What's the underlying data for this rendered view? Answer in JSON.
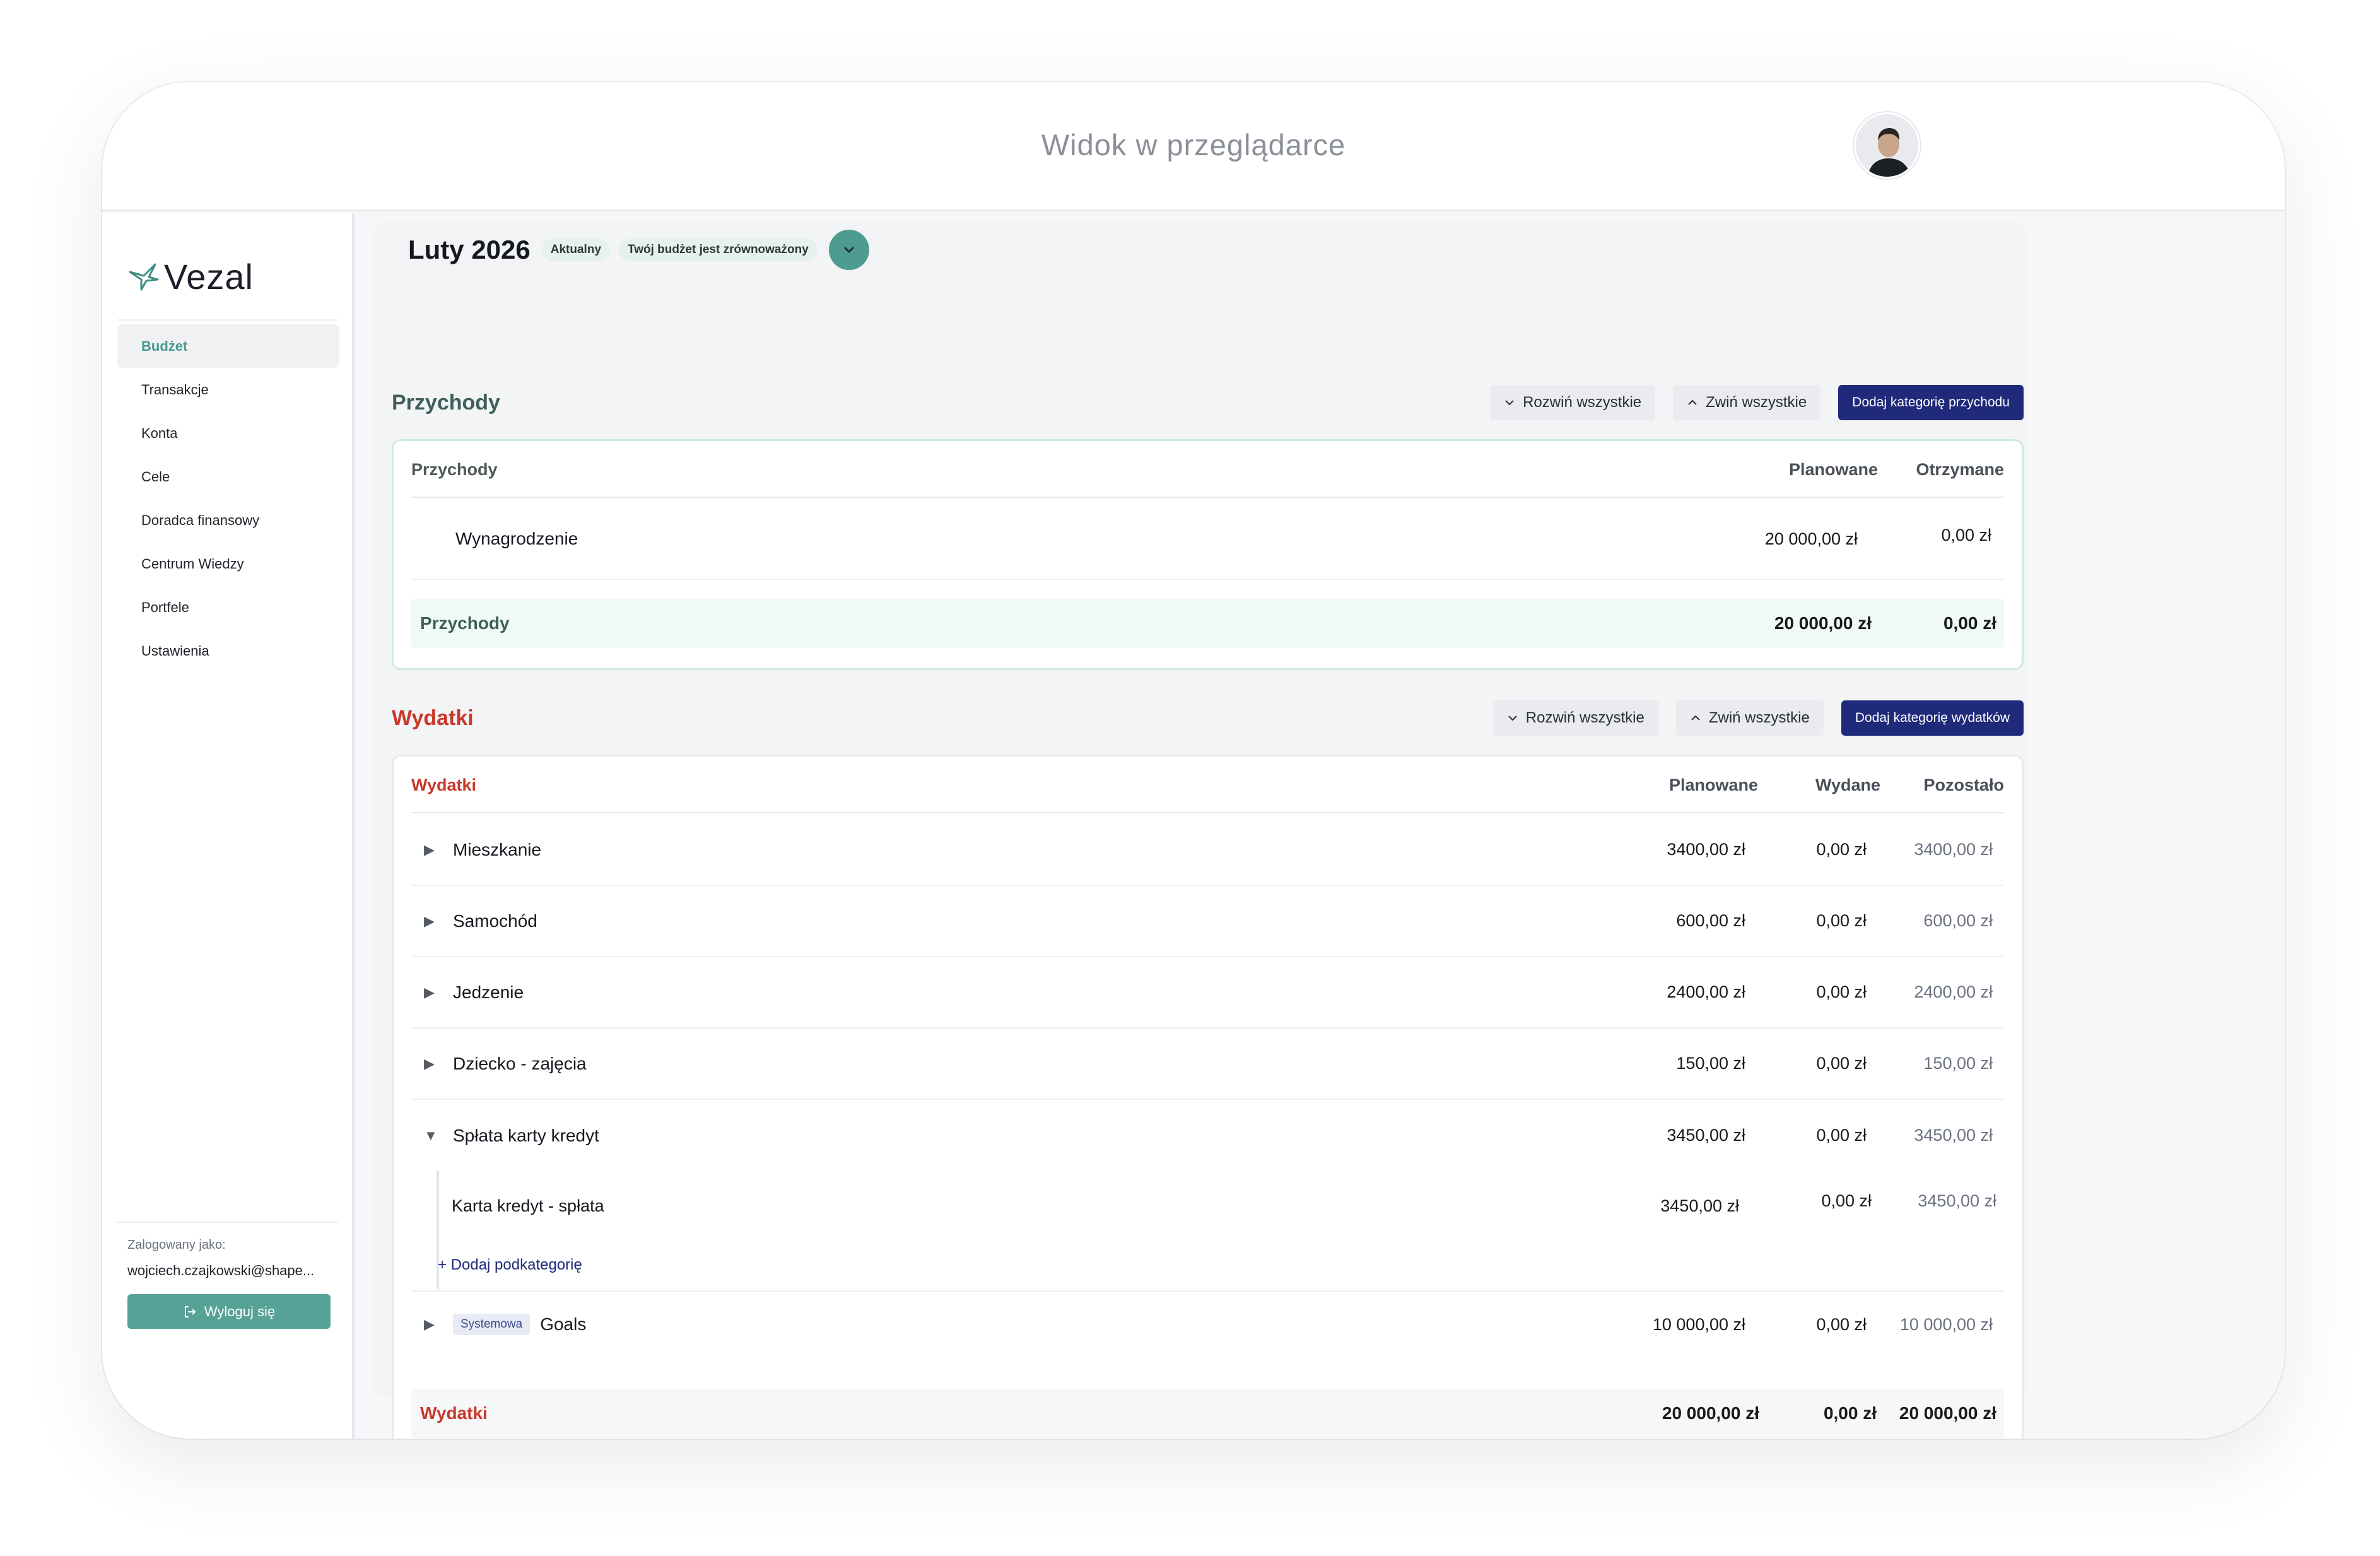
{
  "topbar": {
    "title": "Widok w przeglądarce"
  },
  "sidebar": {
    "logo": "Vezal",
    "items": [
      {
        "label": "Budżet"
      },
      {
        "label": "Transakcje"
      },
      {
        "label": "Konta"
      },
      {
        "label": "Cele"
      },
      {
        "label": "Doradca finansowy"
      },
      {
        "label": "Centrum Wiedzy"
      },
      {
        "label": "Portfele"
      },
      {
        "label": "Ustawienia"
      }
    ],
    "logged_label": "Zalogowany jako:",
    "email": "wojciech.czajkowski@shape...",
    "logout_label": "Wyloguj się"
  },
  "header": {
    "month": "Luty 2026",
    "badge_current": "Aktualny",
    "badge_status": "Twój budżet jest zrównoważony"
  },
  "income": {
    "title": "Przychody",
    "expand_label": "Rozwiń wszystkie",
    "collapse_label": "Zwiń wszystkie",
    "add_label": "Dodaj kategorię przychodu",
    "table": {
      "col_name": "Przychody",
      "col_planned": "Planowane",
      "col_received": "Otrzymane",
      "rows": [
        {
          "name": "Wynagrodzenie",
          "planned": "20 000,00 zł",
          "received": "0,00 zł"
        }
      ],
      "total": {
        "name": "Przychody",
        "planned": "20 000,00 zł",
        "received": "0,00 zł"
      }
    }
  },
  "expenses": {
    "title": "Wydatki",
    "expand_label": "Rozwiń wszystkie",
    "collapse_label": "Zwiń wszystkie",
    "add_label": "Dodaj kategorię wydatków",
    "table": {
      "col_name": "Wydatki",
      "col_planned": "Planowane",
      "col_spent": "Wydane",
      "col_remaining": "Pozostało",
      "rows": [
        {
          "name": "Mieszkanie",
          "planned": "3400,00 zł",
          "spent": "0,00 zł",
          "remaining": "3400,00 zł"
        },
        {
          "name": "Samochód",
          "planned": "600,00 zł",
          "spent": "0,00 zł",
          "remaining": "600,00 zł"
        },
        {
          "name": "Jedzenie",
          "planned": "2400,00 zł",
          "spent": "0,00 zł",
          "remaining": "2400,00 zł"
        },
        {
          "name": "Dziecko - zajęcia",
          "planned": "150,00 zł",
          "spent": "0,00 zł",
          "remaining": "150,00 zł"
        },
        {
          "name": "Spłata karty kredyt",
          "planned": "3450,00 zł",
          "spent": "0,00 zł",
          "remaining": "3450,00 zł"
        }
      ],
      "subcategory": {
        "name": "Karta kredyt - spłata",
        "planned": "3450,00 zł",
        "spent": "0,00 zł",
        "remaining": "3450,00 zł"
      },
      "add_sub_label": "+ Dodaj podkategorię",
      "system_row": {
        "badge": "Systemowa",
        "name": "Goals",
        "planned": "10 000,00 zł",
        "spent": "0,00 zł",
        "remaining": "10 000,00 zł"
      },
      "total": {
        "name": "Wydatki",
        "planned": "20 000,00 zł",
        "spent": "0,00 zł",
        "remaining": "20 000,00 zł"
      }
    }
  },
  "colors": {
    "accent": "#56a297",
    "primary": "#1f2a7a",
    "expense_red": "#c8392b"
  }
}
